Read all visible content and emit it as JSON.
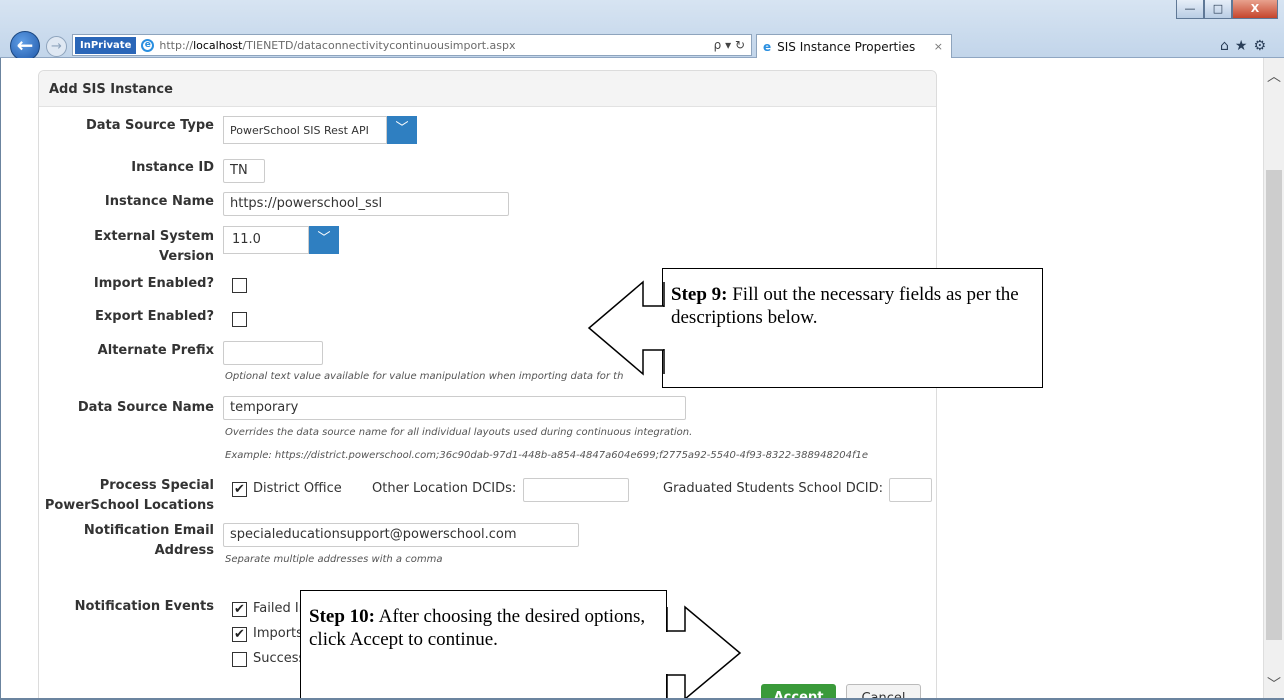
{
  "browser": {
    "mode_badge": "InPrivate",
    "url_prefix": "http://",
    "url_host": "localhost",
    "url_path": "/TIENETD/dataconnectivitycontinuousimport.aspx",
    "addr_controls": "ρ ▾ ↻",
    "tab_title": "SIS Instance Properties",
    "tab_close": "×",
    "toolbar_icons": "⌂★⚙",
    "window_buttons": {
      "minimize": "—",
      "maximize": "□",
      "close": "X"
    }
  },
  "panel": {
    "title": "Add SIS Instance"
  },
  "form": {
    "data_source_type": {
      "label": "Data Source Type",
      "value": "PowerSchool SIS Rest API"
    },
    "instance_id": {
      "label": "Instance ID",
      "value": "TN"
    },
    "instance_name": {
      "label": "Instance Name",
      "value": "https://powerschool_ssl"
    },
    "external_system_version": {
      "label1": "External System",
      "label2": "Version",
      "value": "11.0"
    },
    "import_enabled": {
      "label": "Import Enabled?"
    },
    "export_enabled": {
      "label": "Export Enabled?"
    },
    "alternate_prefix": {
      "label": "Alternate Prefix",
      "value": "",
      "help": "Optional text value available for value manipulation when importing data for th"
    },
    "data_source_name": {
      "label": "Data Source Name",
      "value": "temporary",
      "help": "Overrides the data source name for all individual layouts used during continuous integration.",
      "example": "Example: https://district.powerschool.com;36c90dab-97d1-448b-a854-4847a604e699;f2775a92-5540-4f93-8322-388948204f1e"
    },
    "process_special": {
      "label1": "Process Special",
      "label2": "PowerSchool Locations",
      "district_office": "District Office",
      "other_location": "Other Location DCIDs:",
      "graduated": "Graduated Students School DCID:"
    },
    "notification_email": {
      "label1": "Notification Email",
      "label2": "Address",
      "value": "specialeducationsupport@powerschool.com",
      "help": "Separate multiple addresses with a comma"
    },
    "notification_events": {
      "label": "Notification Events",
      "options": [
        "Failed In",
        "Imports",
        "Success"
      ]
    }
  },
  "buttons": {
    "accept": "Accept",
    "cancel": "Cancel"
  },
  "callouts": {
    "step9": {
      "bold": "Step 9:",
      "text": " Fill out the necessary fields as per the descriptions below."
    },
    "step10": {
      "bold": "Step 10:",
      "text": " After choosing the desired options, click Accept to continue."
    }
  }
}
